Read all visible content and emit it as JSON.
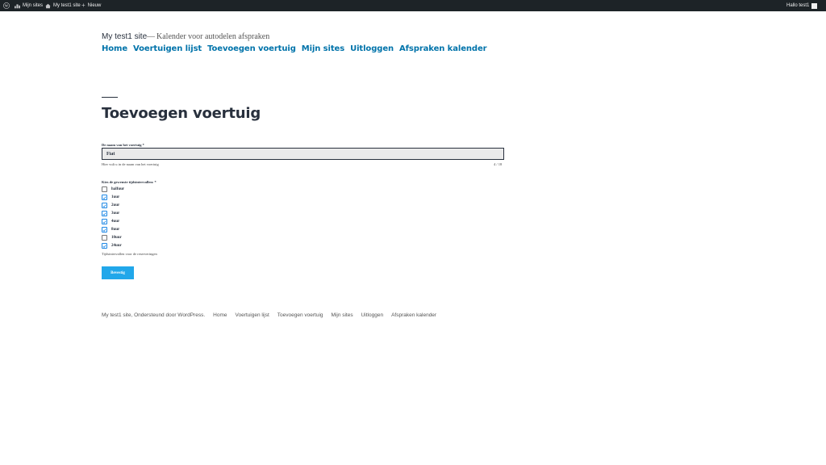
{
  "adminbar": {
    "my_sites": "Mijn sites",
    "site_name": "My test1 site",
    "new": "Nieuw",
    "greeting": "Hallo test1"
  },
  "header": {
    "site_title": "My test1 site",
    "separator": "—",
    "description": "Kalender voor autodelen afspraken",
    "nav": [
      "Home",
      "Voertuigen lijst",
      "Toevoegen voertuig",
      "Mijn sites",
      "Uitloggen",
      "Afspraken kalender"
    ]
  },
  "page": {
    "title": "Toevoegen voertuig"
  },
  "form": {
    "name_label": "De naam van het voertuig *",
    "name_value": "Fiat",
    "name_help": "Hier vult u in de naam van het voertuig",
    "name_counter": "4 / 18",
    "interval_label": "Kies de gewenste tijdsintervallen: *",
    "intervals": [
      {
        "label": "halfuur",
        "checked": false
      },
      {
        "label": "1uur",
        "checked": true
      },
      {
        "label": "2uur",
        "checked": true
      },
      {
        "label": "3uur",
        "checked": true
      },
      {
        "label": "4uur",
        "checked": true
      },
      {
        "label": "8uur",
        "checked": true
      },
      {
        "label": "10uur",
        "checked": false
      },
      {
        "label": "24uur",
        "checked": true
      }
    ],
    "interval_help": "Tijdsintervallen voor de reserveringen",
    "submit_label": "Bevestig",
    "accent_color": "#21a7ea"
  },
  "footer": {
    "credit": "My test1 site, Ondersteund door WordPress.",
    "links": [
      "Home",
      "Voertuigen lijst",
      "Toevoegen voertuig",
      "Mijn sites",
      "Uitloggen",
      "Afspraken kalender"
    ]
  }
}
